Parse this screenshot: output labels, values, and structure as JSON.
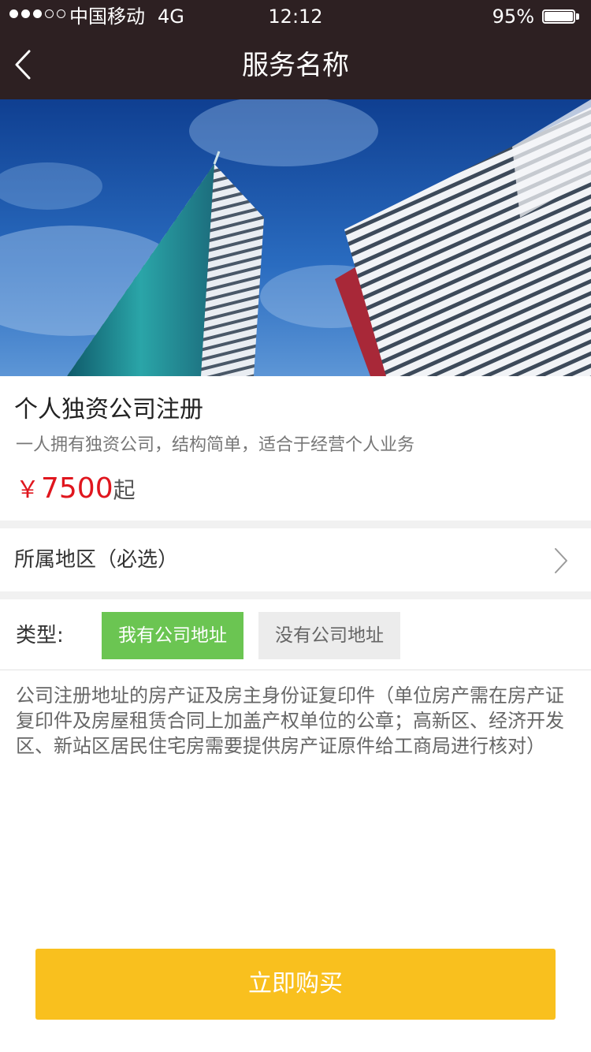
{
  "status_bar": {
    "carrier": "中国移动",
    "network": "4G",
    "time": "12:12",
    "battery_percent": "95%",
    "battery_level": 0.95,
    "signal_bars": 3,
    "signal_total": 5
  },
  "nav": {
    "title": "服务名称",
    "back_icon": "chevron-left-icon"
  },
  "product": {
    "title": "个人独资公司注册",
    "description": "一人拥有独资公司，结构简单，适合于经营个人业务",
    "price_symbol": "￥",
    "price": "7500",
    "price_suffix": "起"
  },
  "region": {
    "label": "所属地区（必选）",
    "icon": "chevron-right-icon"
  },
  "type": {
    "label": "类型:",
    "options": [
      {
        "label": "我有公司地址",
        "selected": true
      },
      {
        "label": "没有公司地址",
        "selected": false
      }
    ]
  },
  "requirements": {
    "text": "公司注册地址的房产证及房主身份证复印件（单位房产需在房产证复印件及房屋租赁合同上加盖产权单位的公章；高新区、经济开发区、新站区居民住宅房需要提供房产证原件给工商局进行核对）"
  },
  "buy_button": {
    "label": "立即购买"
  },
  "colors": {
    "nav_background": "#2d2022",
    "price": "#e0161e",
    "selected_option": "#6bc552",
    "unselected_option": "#ececec",
    "buy_button": "#f9c01e",
    "section_gap": "#f1f1f1"
  }
}
